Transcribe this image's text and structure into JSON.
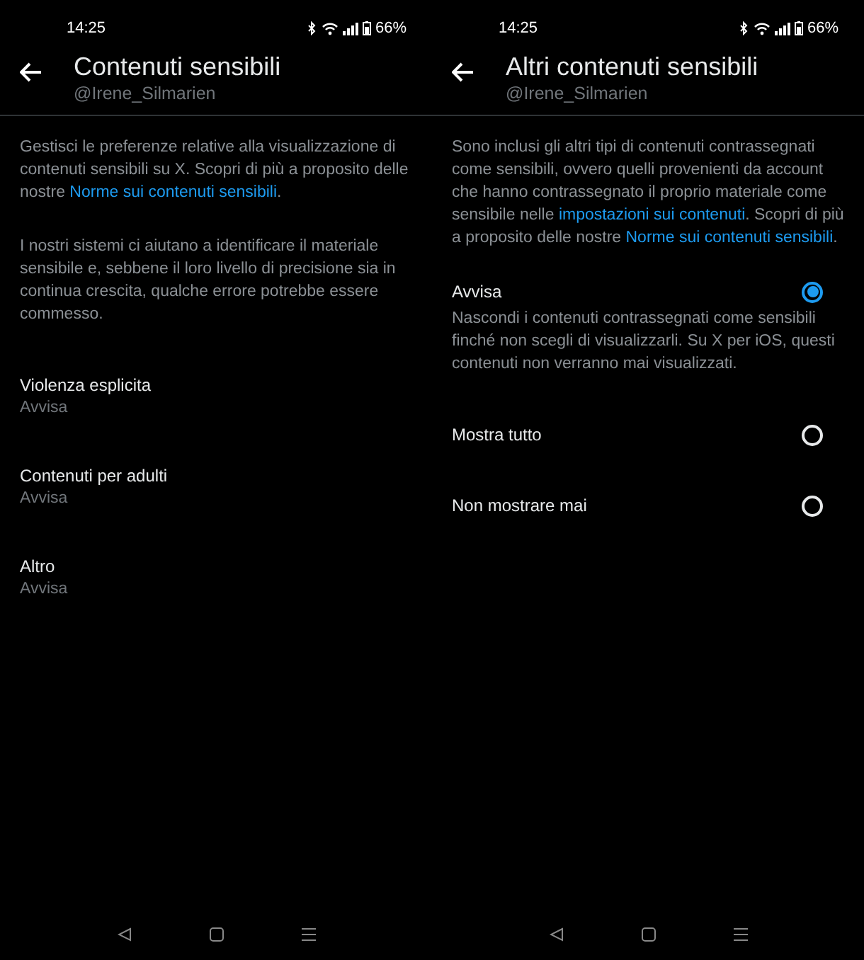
{
  "screens": [
    {
      "status_bar": {
        "time": "14:25",
        "battery": "66%"
      },
      "header": {
        "title": "Contenuti sensibili",
        "handle": "@Irene_Silmarien"
      },
      "paragraphs": [
        [
          {
            "text": "Gestisci le preferenze relative alla visualizzazione di contenuti sensibili su X. Scopri di più a proposito delle nostre ",
            "link": false
          },
          {
            "text": "Norme sui contenuti sensibili",
            "link": true
          },
          {
            "text": ".",
            "link": false
          }
        ],
        [
          {
            "text": "I nostri sistemi ci aiutano a identificare il materiale sensibile e, sebbene il loro livello di precisione sia in continua crescita, qualche errore potrebbe essere commesso.",
            "link": false
          }
        ]
      ],
      "settings": [
        {
          "label": "Violenza esplicita",
          "value": "Avvisa"
        },
        {
          "label": "Contenuti per adulti",
          "value": "Avvisa"
        },
        {
          "label": "Altro",
          "value": "Avvisa"
        }
      ]
    },
    {
      "status_bar": {
        "time": "14:25",
        "battery": "66%"
      },
      "header": {
        "title": "Altri contenuti sensibili",
        "handle": "@Irene_Silmarien"
      },
      "paragraphs": [
        [
          {
            "text": "Sono inclusi gli altri tipi di contenuti contrassegnati come sensibili, ovvero quelli provenienti da account che hanno contrassegnato il proprio materiale come sensibile nelle ",
            "link": false
          },
          {
            "text": "impostazioni sui contenuti",
            "link": true
          },
          {
            "text": ". Scopri di più a proposito delle nostre ",
            "link": false
          },
          {
            "text": "Norme sui contenuti sensibili",
            "link": true
          },
          {
            "text": ".",
            "link": false
          }
        ]
      ],
      "options": [
        {
          "label": "Avvisa",
          "description": "Nascondi i contenuti contrassegnati come sensibili finché non scegli di visualizzarli. Su X per iOS, questi contenuti non verranno mai visualizzati.",
          "selected": true
        },
        {
          "label": "Mostra tutto",
          "selected": false
        },
        {
          "label": "Non mostrare mai",
          "selected": false
        }
      ]
    }
  ]
}
